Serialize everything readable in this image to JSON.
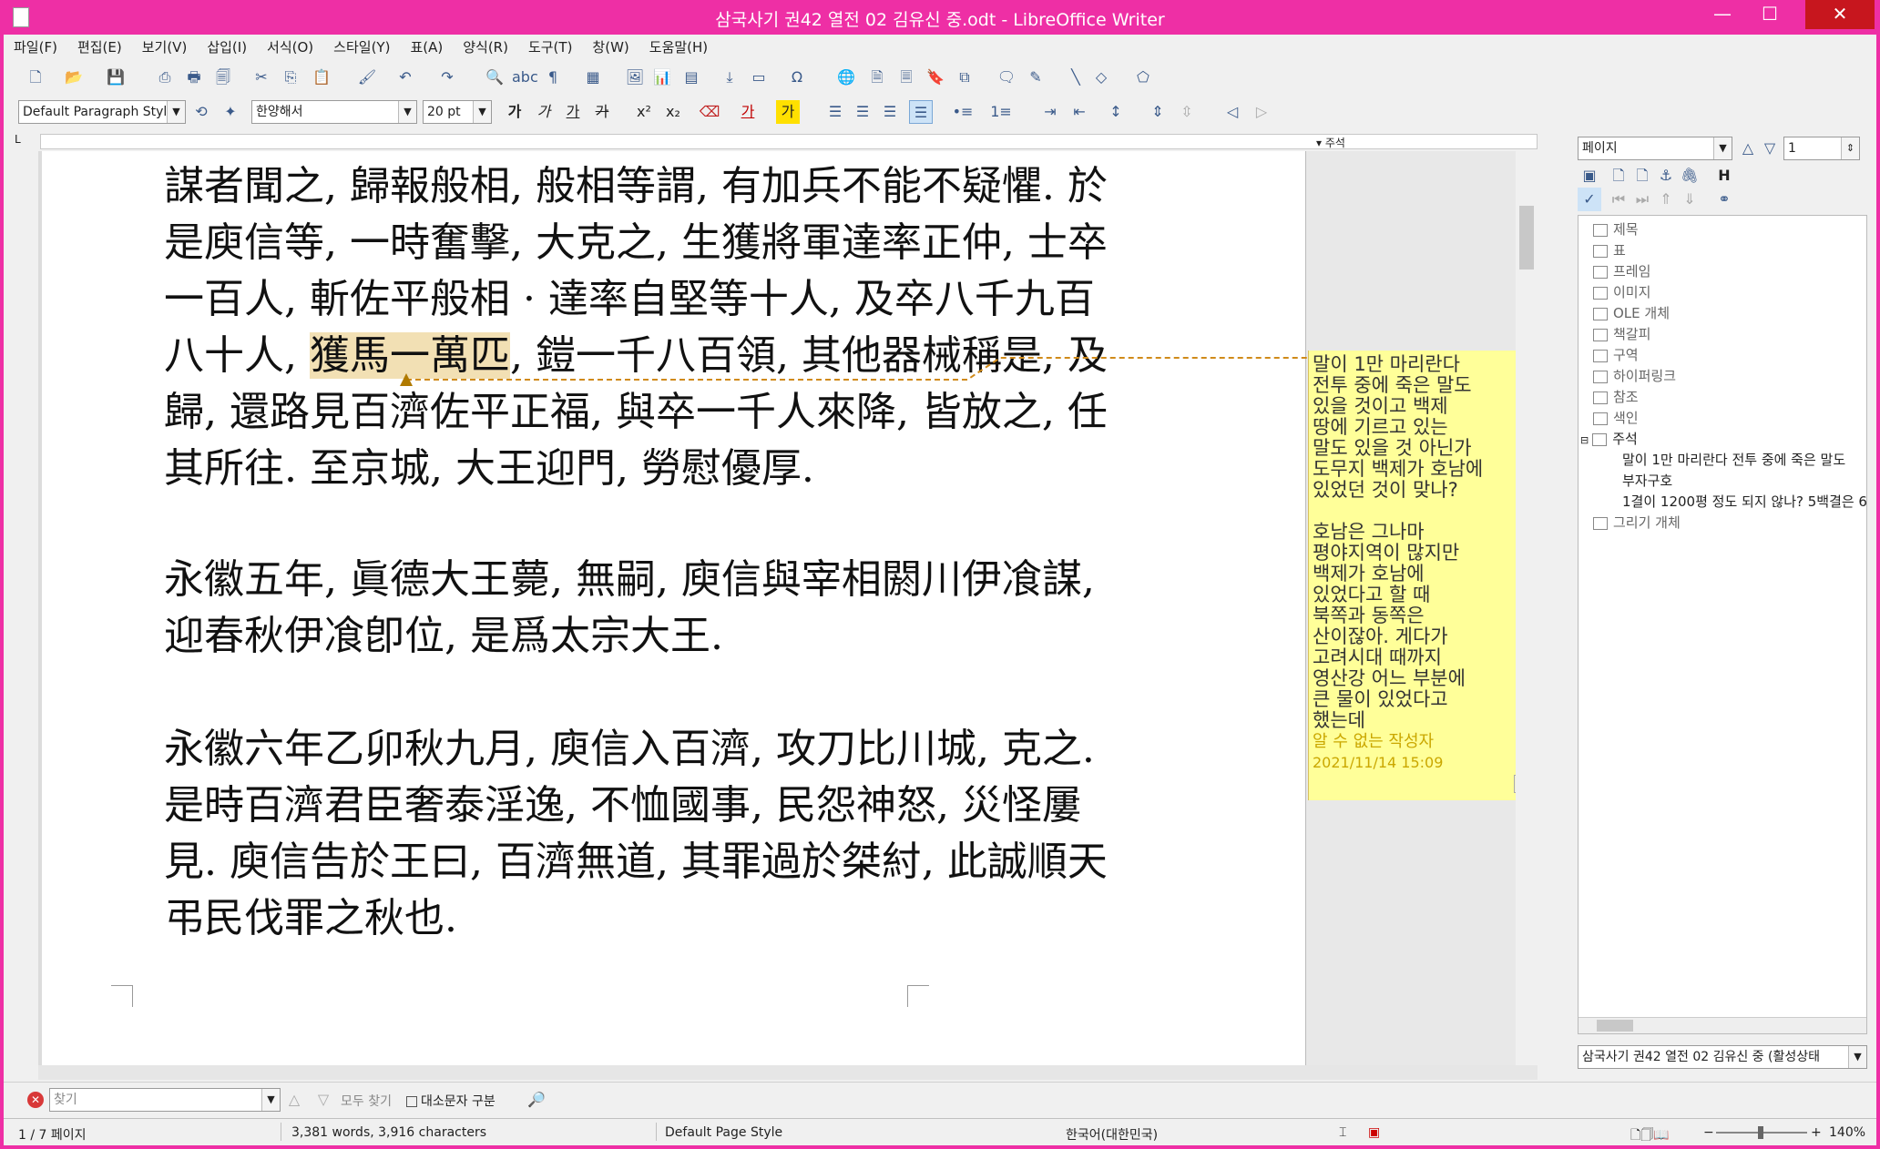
{
  "window": {
    "title": "삼국사기 권42 열전 02 김유신 중.odt - LibreOffice Writer",
    "minimize": "—",
    "maximize": "☐",
    "close": "✕"
  },
  "menu": [
    "파일(F)",
    "편집(E)",
    "보기(V)",
    "삽입(I)",
    "서식(O)",
    "스타일(Y)",
    "표(A)",
    "양식(R)",
    "도구(T)",
    "창(W)",
    "도움말(H)"
  ],
  "format": {
    "para_style": "Default Paragraph Styl",
    "font_name": "한양해서",
    "font_size": "20 pt",
    "bold": "가",
    "italic": "가",
    "underline": "가",
    "strike": "가",
    "super": "x²",
    "sub": "x₂"
  },
  "ruler": {
    "comments_label": "▾ 주석"
  },
  "document": {
    "p1": [
      "謀者聞之, 歸報般相, 般相等謂, 有加兵不能不疑懼. 於",
      "是庾信等, 一時奮擊, 大克之, 生獲將軍達率正仲, 士卒",
      "一百人, 斬佐平般相 · 達率自堅等十人, 及卒八千九百"
    ],
    "p1_l4_pre": "八十人, ",
    "p1_l4_hl": "獲馬一萬匹",
    "p1_l4_post": ", 鎧一千八百領, 其他器械稱是, 及",
    "p1_rest": [
      "歸, 還路見百濟佐平正福, 與卒一千人來降, 皆放之, 任",
      "其所往. 至京城, 大王迎門, 勞慰優厚."
    ],
    "p2": [
      "永徽五年, 眞德大王薨, 無嗣, 庾信與宰相閼川伊飡謀,",
      "迎春秋伊飡卽位, 是爲太宗大王."
    ],
    "p3": [
      "永徽六年乙卯秋九月, 庾信入百濟, 攻刀比川城, 克之.",
      "是時百濟君臣奢泰淫逸, 不恤國事, 民怨神怒, 災怪屢",
      "見. 庾信告於王曰, 百濟無道, 其罪過於桀紂, 此誠順天",
      "弔民伐罪之秋也."
    ]
  },
  "comment": {
    "text1": "말이 1만 마리란다\n전투 중에 죽은 말도\n있을 것이고 백제\n땅에 기르고 있는\n말도 있을 것 아닌가\n도무지 백제가 호남에\n있었던 것이 맞나?",
    "text2": "호남은 그나마\n평야지역이 많지만\n백제가 호남에\n있었다고 할 때\n북쪽과 동쪽은\n산이잖아. 게다가\n고려시대 때까지\n영산강 어느 부분에\n큰 물이 있었다고\n했는데",
    "author": "알 수 없는 작성자",
    "date": "2021/11/14 15:09",
    "menu": "▾"
  },
  "navigator": {
    "type_select": "페이지",
    "page_number": "1",
    "heading_tool": "H",
    "items": [
      "제목",
      "표",
      "프레임",
      "이미지",
      "OLE 개체",
      "책갈피",
      "구역",
      "하이퍼링크",
      "참조",
      "색인",
      "주석"
    ],
    "comments": [
      "말이 1만 마리란다 전투 중에 죽은 말도",
      "부자구호",
      "1결이 1200평 정도 되지 않나? 5백결은 6"
    ],
    "drawing": "그리기 개체",
    "document_select": "삼국사기 권42 열전 02 김유신 중 (활성상태"
  },
  "find": {
    "placeholder": "찾기",
    "find_all": "모두 찾기",
    "match_case": "대소문자 구분"
  },
  "status": {
    "page": "1 / 7 페이지",
    "words": "3,381 words, 3,916 characters",
    "page_style": "Default Page Style",
    "language": "한국어(대한민국)",
    "zoom": "140%"
  },
  "icons": [
    "new-icon",
    "open-icon",
    "save-icon",
    "pdf-icon",
    "print-icon",
    "print-preview-icon",
    "cut-icon",
    "copy-icon",
    "paste-icon",
    "clone-icon",
    "undo-icon",
    "redo-icon",
    "find-replace-icon",
    "spellcheck-icon",
    "formatting-marks-icon",
    "table-icon",
    "image-icon",
    "chart-icon",
    "textbox-icon",
    "page-break-icon",
    "field-icon",
    "special-char-icon",
    "hyperlink-icon",
    "footnote-icon",
    "endnote-icon",
    "bookmark-icon",
    "cross-ref-icon",
    "comment-icon",
    "track-changes-icon",
    "line-icon",
    "shapes-icon",
    "draw-icon"
  ]
}
